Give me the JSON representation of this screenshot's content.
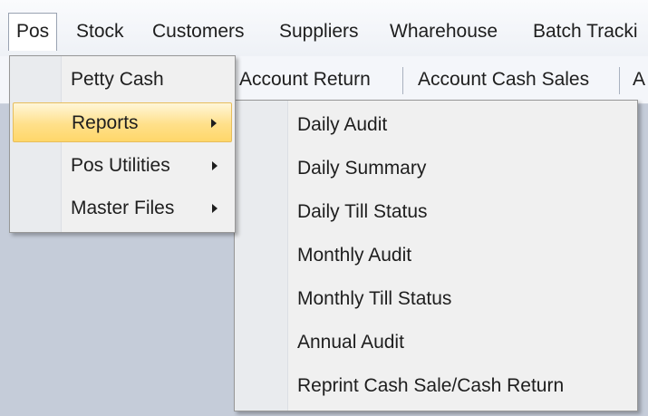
{
  "menubar": {
    "items": [
      {
        "label": "Pos"
      },
      {
        "label": "Stock"
      },
      {
        "label": "Customers"
      },
      {
        "label": "Suppliers"
      },
      {
        "label": "Wharehouse"
      },
      {
        "label": "Batch Tracki"
      }
    ]
  },
  "toolbar": {
    "buttons": [
      {
        "label": "Account Return"
      },
      {
        "label": "Account Cash Sales"
      },
      {
        "label": "A"
      }
    ]
  },
  "pos_menu": {
    "items": [
      {
        "label": "Petty Cash"
      },
      {
        "label": "Reports"
      },
      {
        "label": "Pos Utilities"
      },
      {
        "label": "Master Files"
      }
    ]
  },
  "reports_submenu": {
    "items": [
      {
        "label": "Daily Audit"
      },
      {
        "label": "Daily Summary"
      },
      {
        "label": "Daily Till Status"
      },
      {
        "label": "Monthly Audit"
      },
      {
        "label": "Monthly Till Status"
      },
      {
        "label": "Annual Audit"
      },
      {
        "label": "Reprint Cash Sale/Cash Return"
      }
    ]
  },
  "colors": {
    "highlight": "#ffe08a",
    "background": "#c5ccd9",
    "menu": "#f0f0f0"
  }
}
